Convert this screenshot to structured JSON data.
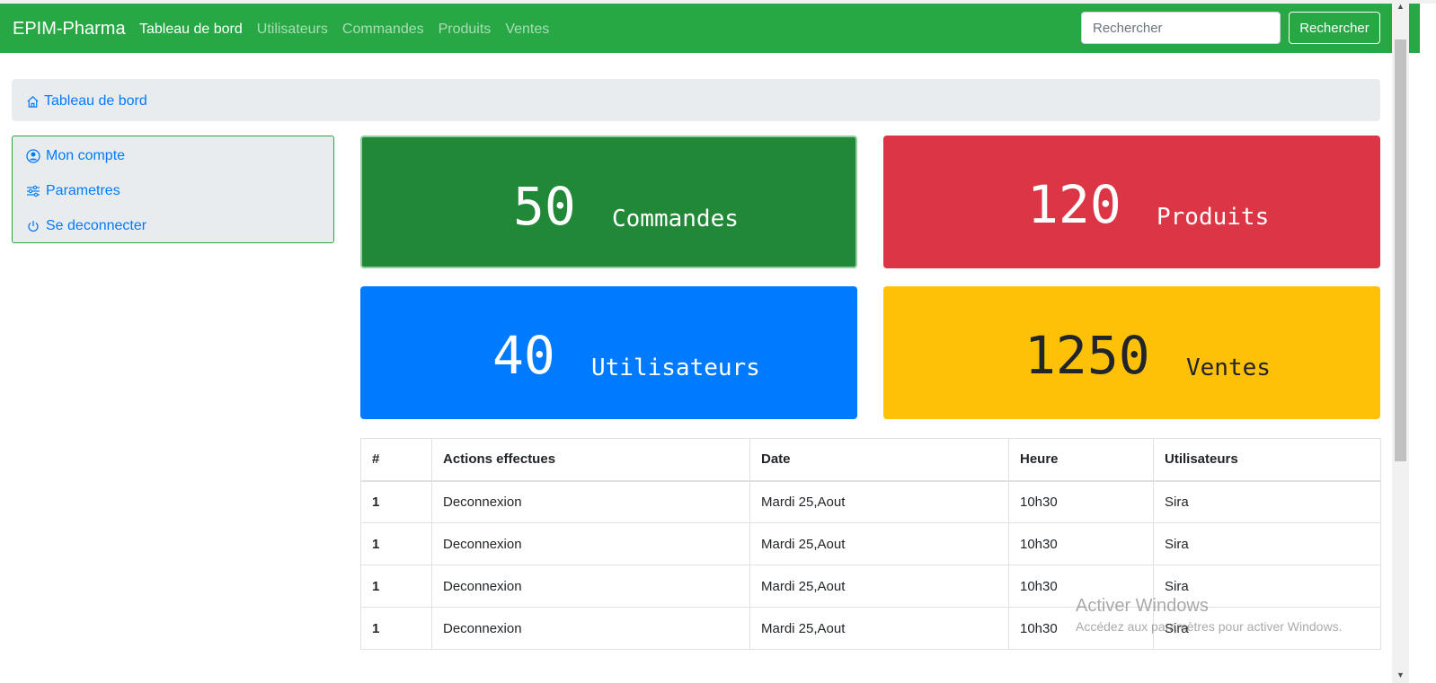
{
  "navbar": {
    "brand": "EPIM-Pharma",
    "links": [
      {
        "label": "Tableau de bord",
        "active": true
      },
      {
        "label": "Utilisateurs",
        "active": false
      },
      {
        "label": "Commandes",
        "active": false
      },
      {
        "label": "Produits",
        "active": false
      },
      {
        "label": "Ventes",
        "active": false
      }
    ],
    "search_placeholder": "Rechercher",
    "search_button": "Rechercher"
  },
  "breadcrumb": {
    "icon": "home-icon",
    "label": "Tableau de bord"
  },
  "sidebar": {
    "items": [
      {
        "icon": "user-circle-icon",
        "label": "Mon compte"
      },
      {
        "icon": "sliders-icon",
        "label": "Parametres"
      },
      {
        "icon": "power-icon",
        "label": "Se deconnecter"
      }
    ]
  },
  "stats": {
    "commandes": {
      "value": "50",
      "label": "Commandes",
      "color": "#218838"
    },
    "produits": {
      "value": "120",
      "label": "Produits",
      "color": "#dc3545"
    },
    "utilisateurs": {
      "value": "40",
      "label": "Utilisateurs",
      "color": "#007bff"
    },
    "ventes": {
      "value": "1250",
      "label": "Ventes",
      "color": "#ffc107"
    }
  },
  "table": {
    "headers": [
      "#",
      "Actions effectues",
      "Date",
      "Heure",
      "Utilisateurs"
    ],
    "rows": [
      [
        "1",
        "Deconnexion",
        "Mardi 25,Aout",
        "10h30",
        "Sira"
      ],
      [
        "1",
        "Deconnexion",
        "Mardi 25,Aout",
        "10h30",
        "Sira"
      ],
      [
        "1",
        "Deconnexion",
        "Mardi 25,Aout",
        "10h30",
        "Sira"
      ],
      [
        "1",
        "Deconnexion",
        "Mardi 25,Aout",
        "10h30",
        "Sira"
      ]
    ]
  },
  "watermark": {
    "title": "Activer Windows",
    "subtitle": "Accédez aux paramètres pour activer Windows."
  }
}
